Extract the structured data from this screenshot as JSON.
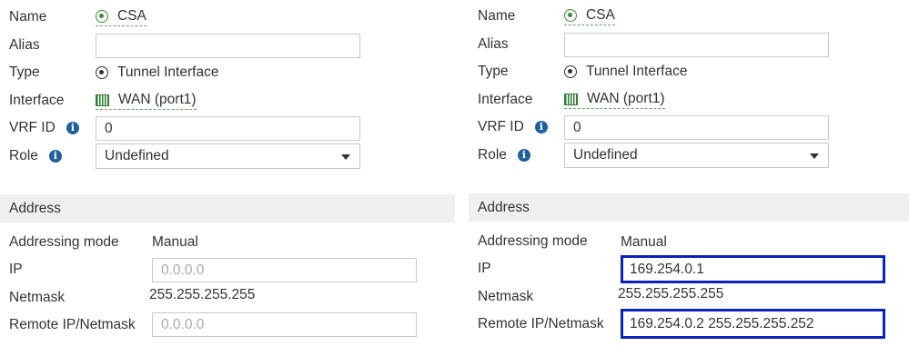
{
  "labels": {
    "name": "Name",
    "alias": "Alias",
    "type": "Type",
    "interface": "Interface",
    "vrf_id": "VRF ID",
    "role": "Role",
    "address_section": "Address",
    "addressing_mode": "Addressing mode",
    "ip": "IP",
    "netmask": "Netmask",
    "remote_ip_netmask": "Remote IP/Netmask"
  },
  "left": {
    "name": "CSA",
    "alias": "",
    "type": "Tunnel Interface",
    "interface": "WAN (port1)",
    "vrf_id": "0",
    "role": "Undefined",
    "addressing_mode": "Manual",
    "ip_placeholder": "0.0.0.0",
    "ip_value": "",
    "netmask": "255.255.255.255",
    "remote_placeholder": "0.0.0.0",
    "remote_value": ""
  },
  "right": {
    "name": "CSA",
    "alias": "",
    "type": "Tunnel Interface",
    "interface": "WAN (port1)",
    "vrf_id": "0",
    "role": "Undefined",
    "addressing_mode": "Manual",
    "ip_value": "169.254.0.1",
    "netmask": "255.255.255.255",
    "remote_value": "169.254.0.2 255.255.255.252"
  },
  "icons": {
    "name": "tunnel-icon",
    "type": "tunnel-icon",
    "interface": "port-icon",
    "info": "info-icon",
    "dropdown": "caret-down-icon"
  },
  "colors": {
    "highlight_border": "#0a22b8",
    "section_bg": "#efefef",
    "info_icon": "#1f5f9e",
    "link_green": "#3b8a3b"
  }
}
